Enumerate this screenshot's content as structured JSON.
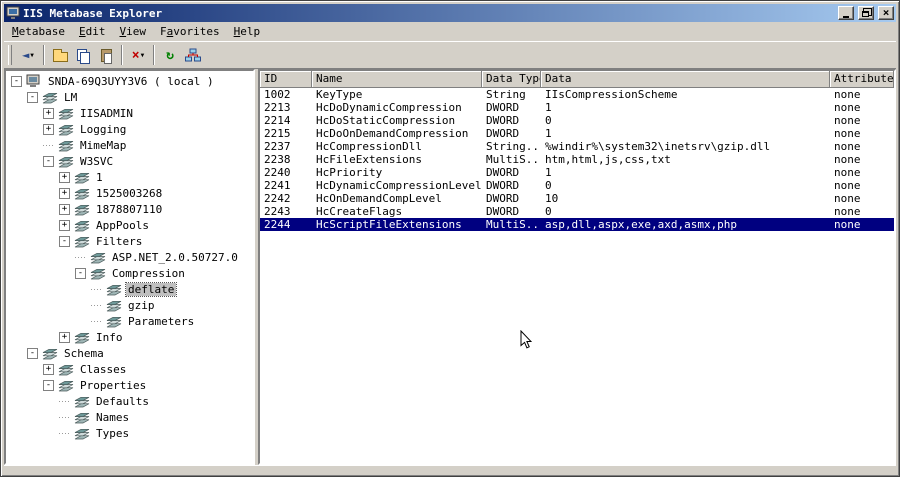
{
  "window": {
    "title": "IIS Metabase Explorer"
  },
  "icons": {
    "collapse": "-",
    "expand": "+",
    "back": "◄",
    "dropdown_caret": "▼",
    "delete": "×",
    "refresh": "↻",
    "close": "×",
    "minimize": "css-shape",
    "restore": "css-shape",
    "folder_up": "css-shape",
    "copy": "css-shape",
    "paste": "css-shape",
    "network": "css-shape",
    "computer": "css-shape",
    "metabase_key": "css-shape"
  },
  "menu": {
    "items": [
      {
        "label": "Metabase",
        "accel": 0
      },
      {
        "label": "Edit",
        "accel": 0
      },
      {
        "label": "View",
        "accel": 0
      },
      {
        "label": "Favorites",
        "accel": 1
      },
      {
        "label": "Help",
        "accel": 0
      }
    ]
  },
  "tree": {
    "items": [
      {
        "level": 0,
        "label": "SNDA-69Q3UYY3V6 ( local )",
        "toggle": "minus",
        "icon": "computer",
        "selected": false
      },
      {
        "level": 1,
        "label": "LM",
        "toggle": "minus",
        "icon": "key",
        "selected": false
      },
      {
        "level": 2,
        "label": "IISADMIN",
        "toggle": "plus",
        "icon": "key",
        "selected": false
      },
      {
        "level": 2,
        "label": "Logging",
        "toggle": "plus",
        "icon": "key",
        "selected": false
      },
      {
        "level": 2,
        "label": "MimeMap",
        "toggle": "none",
        "icon": "key",
        "selected": false
      },
      {
        "level": 2,
        "label": "W3SVC",
        "toggle": "minus",
        "icon": "key",
        "selected": false
      },
      {
        "level": 3,
        "label": "1",
        "toggle": "plus",
        "icon": "key",
        "selected": false
      },
      {
        "level": 3,
        "label": "1525003268",
        "toggle": "plus",
        "icon": "key",
        "selected": false
      },
      {
        "level": 3,
        "label": "1878807110",
        "toggle": "plus",
        "icon": "key",
        "selected": false
      },
      {
        "level": 3,
        "label": "AppPools",
        "toggle": "plus",
        "icon": "key",
        "selected": false
      },
      {
        "level": 3,
        "label": "Filters",
        "toggle": "minus",
        "icon": "key",
        "selected": false
      },
      {
        "level": 4,
        "label": "ASP.NET_2.0.50727.0",
        "toggle": "none",
        "icon": "key",
        "selected": false
      },
      {
        "level": 4,
        "label": "Compression",
        "toggle": "minus",
        "icon": "key",
        "selected": false
      },
      {
        "level": 5,
        "label": "deflate",
        "toggle": "none",
        "icon": "key",
        "selected": true
      },
      {
        "level": 5,
        "label": "gzip",
        "toggle": "none",
        "icon": "key",
        "selected": false
      },
      {
        "level": 5,
        "label": "Parameters",
        "toggle": "none",
        "icon": "key",
        "selected": false
      },
      {
        "level": 3,
        "label": "Info",
        "toggle": "plus",
        "icon": "key",
        "selected": false
      },
      {
        "level": 1,
        "label": "Schema",
        "toggle": "minus",
        "icon": "key",
        "selected": false
      },
      {
        "level": 2,
        "label": "Classes",
        "toggle": "plus",
        "icon": "key",
        "selected": false
      },
      {
        "level": 2,
        "label": "Properties",
        "toggle": "minus",
        "icon": "key",
        "selected": false
      },
      {
        "level": 3,
        "label": "Defaults",
        "toggle": "none",
        "icon": "key",
        "selected": false
      },
      {
        "level": 3,
        "label": "Names",
        "toggle": "none",
        "icon": "key",
        "selected": false
      },
      {
        "level": 3,
        "label": "Types",
        "toggle": "none",
        "icon": "key",
        "selected": false
      }
    ]
  },
  "table": {
    "columns": [
      "ID",
      "Name",
      "Data Type",
      "Data",
      "Attributes"
    ],
    "rows": [
      [
        "1002",
        "KeyType",
        "String",
        "IIsCompressionScheme",
        "none"
      ],
      [
        "2213",
        "HcDoDynamicCompression",
        "DWORD",
        "1",
        "none"
      ],
      [
        "2214",
        "HcDoStaticCompression",
        "DWORD",
        "0",
        "none"
      ],
      [
        "2215",
        "HcDoOnDemandCompression",
        "DWORD",
        "1",
        "none"
      ],
      [
        "2237",
        "HcCompressionDll",
        "String...",
        "%windir%\\system32\\inetsrv\\gzip.dll",
        "none"
      ],
      [
        "2238",
        "HcFileExtensions",
        "MultiS...",
        "htm,html,js,css,txt",
        "none"
      ],
      [
        "2240",
        "HcPriority",
        "DWORD",
        "1",
        "none"
      ],
      [
        "2241",
        "HcDynamicCompressionLevel",
        "DWORD",
        "0",
        "none"
      ],
      [
        "2242",
        "HcOnDemandCompLevel",
        "DWORD",
        "10",
        "none"
      ],
      [
        "2243",
        "HcCreateFlags",
        "DWORD",
        "0",
        "none"
      ],
      [
        "2244",
        "HcScriptFileExtensions",
        "MultiS...",
        "asp,dll,aspx,exe,axd,asmx,php",
        "none"
      ]
    ],
    "selected_row_index": 10
  },
  "colors": {
    "selection": "#000080",
    "titlebar_start": "#0a246a",
    "titlebar_end": "#a6caf0",
    "window_face": "#d4d0c8"
  }
}
